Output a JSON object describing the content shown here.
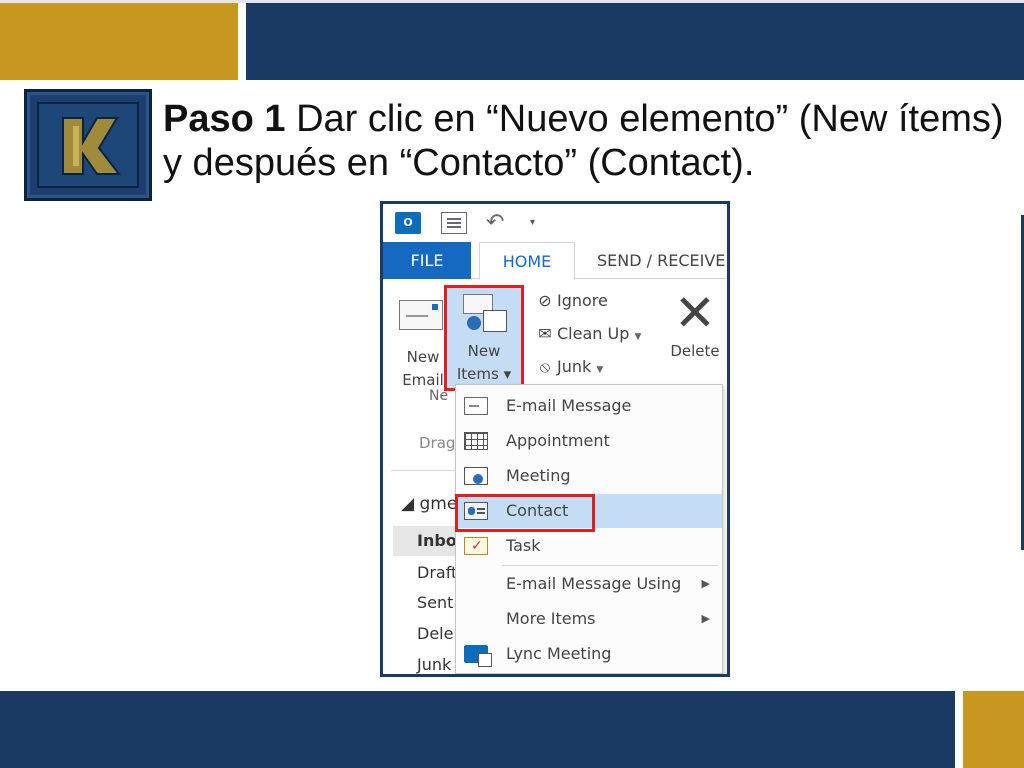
{
  "slide": {
    "title_bold": "Paso 1",
    "title_rest": " Dar clic en “Nuevo elemento” (New ítems) y después en “Contacto” (Contact).",
    "colors": {
      "navy": "#1a3a63",
      "gold": "#c7971f",
      "highlight": "#e02020"
    }
  },
  "outlook": {
    "qat": {
      "app_icon": "outlook-icon",
      "app_icon_text": "O",
      "undo_glyph": "↶",
      "more_glyph": "▾"
    },
    "tabs": [
      {
        "label": "FILE"
      },
      {
        "label": "HOME"
      },
      {
        "label": "SEND / RECEIVE"
      }
    ],
    "ribbon": {
      "new_email": "New Email",
      "new_items": "New Items ▾",
      "ignore": "Ignore",
      "cleanup": "Clean Up",
      "junk": "Junk",
      "delete": "Delete",
      "group_label": "Ne",
      "delete_glyph": "✕"
    },
    "pane": {
      "drag_text": "Drag",
      "account": "◢ gme",
      "folders": [
        "Inbo",
        "Draft",
        "Sent",
        "Dele",
        "Junk"
      ]
    },
    "menu": {
      "items": [
        {
          "label": "E-mail Message",
          "icon": "email-icon"
        },
        {
          "label": "Appointment",
          "icon": "calendar-icon"
        },
        {
          "label": "Meeting",
          "icon": "meeting-icon"
        },
        {
          "label": "Contact",
          "icon": "contact-icon"
        },
        {
          "label": "Task",
          "icon": "task-icon"
        },
        {
          "label": "E-mail Message Using",
          "icon": ""
        },
        {
          "label": "More Items",
          "icon": ""
        },
        {
          "label": "Lync Meeting",
          "icon": "lync-icon"
        }
      ],
      "submenu_arrow": "▶"
    }
  }
}
